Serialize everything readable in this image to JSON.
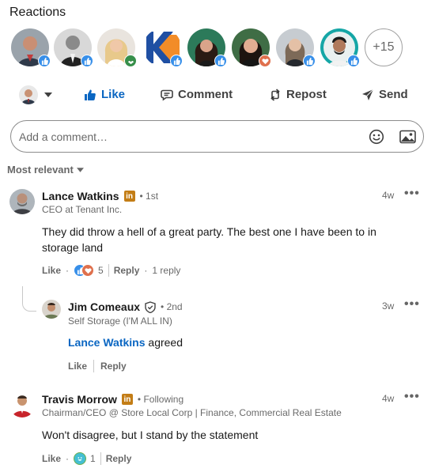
{
  "reactions": {
    "title": "Reactions",
    "more_count": "+15",
    "people": [
      {
        "reaction": "like"
      },
      {
        "reaction": "like"
      },
      {
        "reaction": "support"
      },
      {
        "reaction": "like"
      },
      {
        "reaction": "like"
      },
      {
        "reaction": "love"
      },
      {
        "reaction": "like"
      },
      {
        "reaction": "like"
      }
    ]
  },
  "actions": {
    "like": "Like",
    "comment": "Comment",
    "repost": "Repost",
    "send": "Send"
  },
  "comment_input": {
    "placeholder": "Add a comment…"
  },
  "sort_label": "Most relevant",
  "comments": [
    {
      "name": "Lance Watkins",
      "degree": "• 1st",
      "headline": "CEO at Tenant Inc.",
      "time": "4w",
      "text": "They did throw a hell of a great party. The best one I have been to in storage land",
      "like_label": "Like",
      "reaction_count": "5",
      "reply_label": "Reply",
      "reply_count": "1 reply",
      "reply": {
        "name": "Jim Comeaux",
        "degree": "• 2nd",
        "headline": "Self Storage (I'M ALL IN)",
        "time": "3w",
        "mention": "Lance Watkins",
        "text": " agreed",
        "like_label": "Like",
        "reply_label": "Reply"
      }
    },
    {
      "name": "Travis Morrow",
      "degree": "• Following",
      "headline": "Chairman/CEO @ Store Local Corp | Finance, Commercial Real Estate",
      "time": "4w",
      "text": "Won't disagree, but I stand by the statement",
      "like_label": "Like",
      "reaction_count": "1",
      "reply_label": "Reply"
    }
  ],
  "colors": {
    "linkedin_blue": "#0a66c2",
    "love_red": "#df704d",
    "support_green": "#378f4a",
    "premium_gold": "#c37d16"
  }
}
